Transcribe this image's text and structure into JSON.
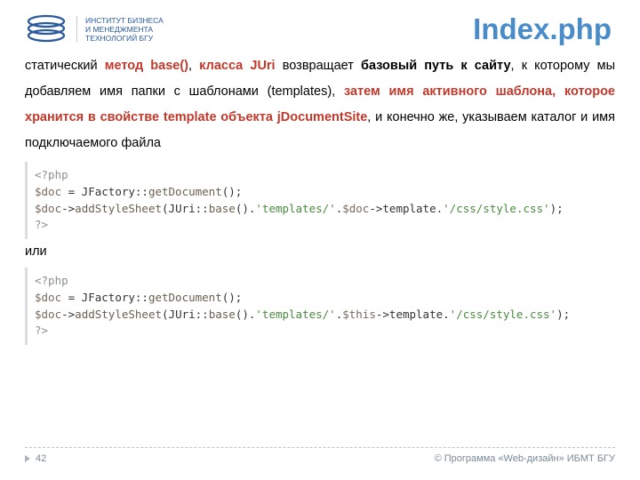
{
  "header": {
    "logo_text": "ИНСТИТУТ БИЗНЕСА\nИ МЕНЕДЖМЕНТА\nТЕХНОЛОГИЙ БГУ",
    "title": "Index.php"
  },
  "body": {
    "p1_a": "статический ",
    "p1_b": "метод base()",
    "p1_c": ", ",
    "p1_d": "класса JUri",
    "p1_e": " возвращает ",
    "p1_f": "базовый путь к сайту",
    "p1_g": ", к которому мы добавляем имя папки с шаблонами (templates), ",
    "p1_h": "затем имя активного шаблона, которое хранится в свойстве template объекта jDocumentSite",
    "p1_i": ", и конечно же, указываем каталог и имя подключаемого файла",
    "or": "или"
  },
  "code1": {
    "l1": "<?php",
    "l2a": "$doc",
    "l2b": " = JFactory::",
    "l2c": "getDocument",
    "l2d": "();",
    "l3a": "$doc",
    "l3b": "->",
    "l3c": "addStyleSheet",
    "l3d": "(JUri::",
    "l3e": "base",
    "l3f": "().",
    "l3g": "'templates/'",
    "l3h": ".",
    "l3i": "$doc",
    "l3j": "->template.",
    "l3k": "'/css/style.css'",
    "l3l": ");",
    "l4": "?>"
  },
  "code2": {
    "l1": "<?php",
    "l2a": "$doc",
    "l2b": " = JFactory::",
    "l2c": "getDocument",
    "l2d": "();",
    "l3a": "$doc",
    "l3b": "->",
    "l3c": "addStyleSheet",
    "l3d": "(JUri::",
    "l3e": "base",
    "l3f": "().",
    "l3g": "'templates/'",
    "l3h": ".",
    "l3i": "$this",
    "l3j": "->template.",
    "l3k": "'/css/style.css'",
    "l3l": ");",
    "l4": "?>"
  },
  "footer": {
    "page": "42",
    "copyright": "© Программа «Web-дизайн» ИБМТ БГУ"
  }
}
